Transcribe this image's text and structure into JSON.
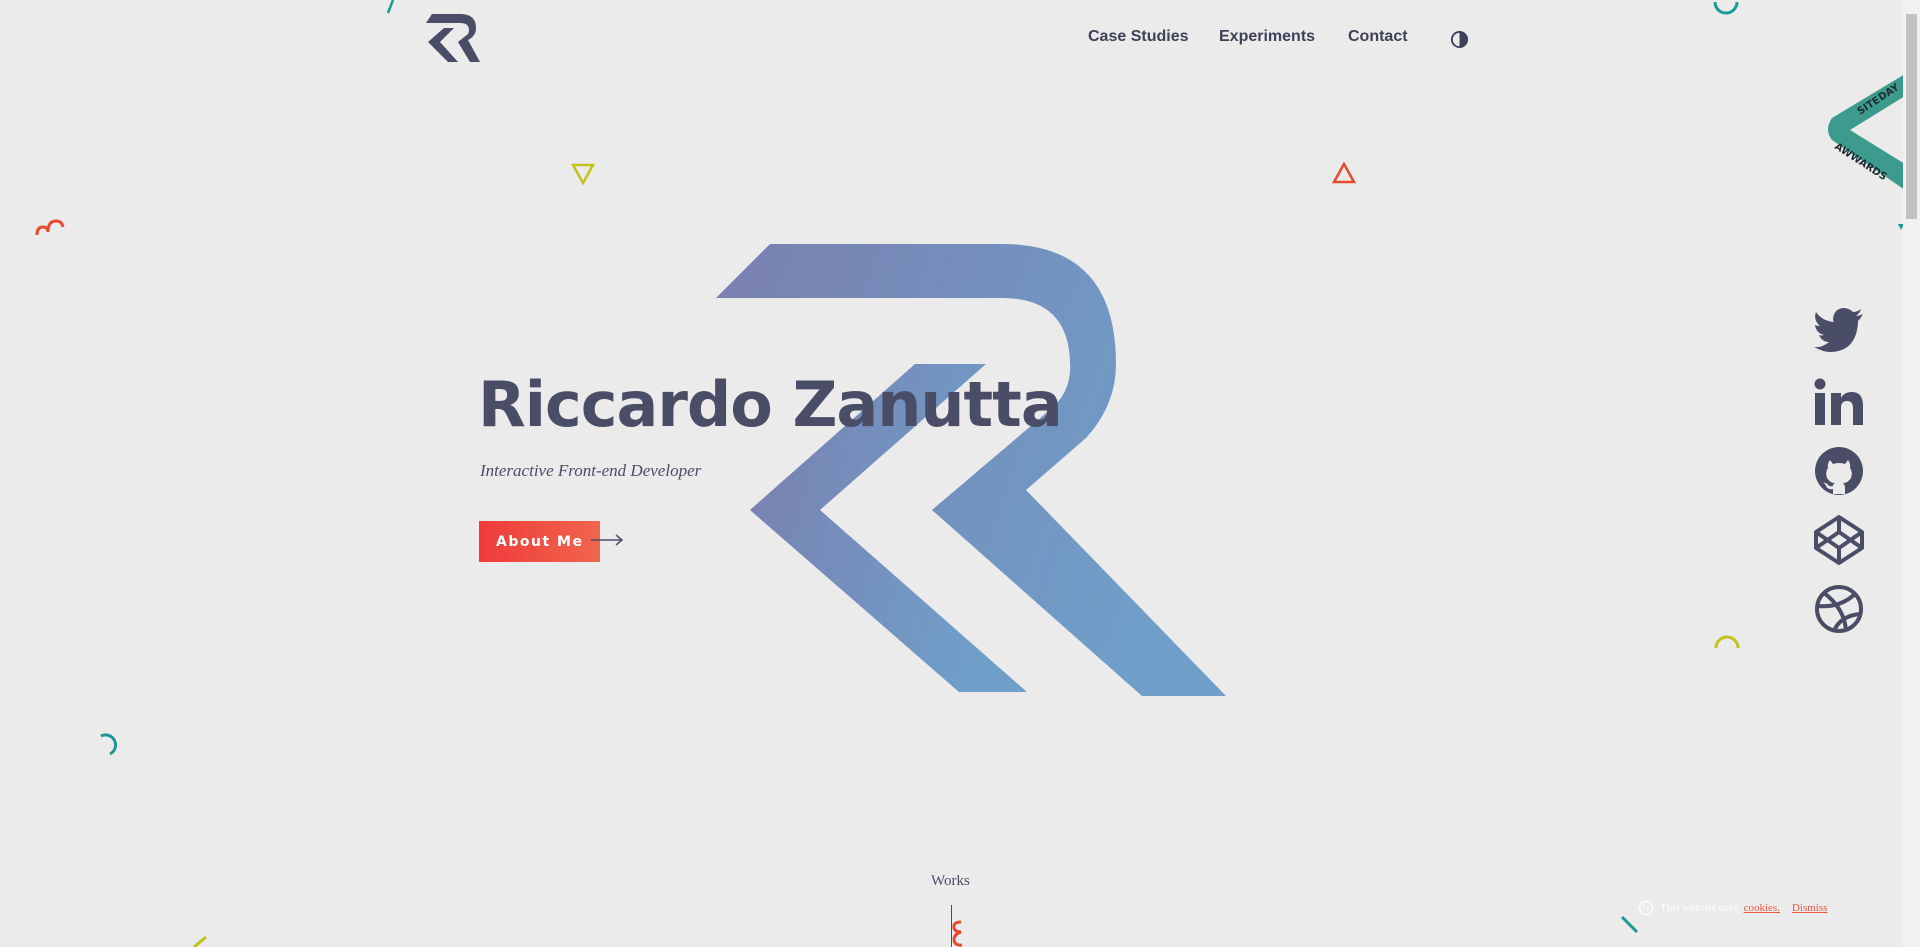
{
  "header": {
    "logo_name": "rz-monogram-logo",
    "nav": [
      {
        "label": "Case Studies"
      },
      {
        "label": "Experiments"
      },
      {
        "label": "Contact"
      }
    ],
    "theme_toggle_icon": "contrast-icon"
  },
  "hero": {
    "title": "Riccardo Zanutta",
    "subtitle": "Interactive Front-end Developer",
    "cta_label": "About Me",
    "cta_arrow_icon": "arrow-right-icon"
  },
  "social": [
    {
      "name": "twitter-icon"
    },
    {
      "name": "linkedin-icon"
    },
    {
      "name": "github-icon"
    },
    {
      "name": "codepen-icon"
    },
    {
      "name": "dribbble-icon"
    }
  ],
  "award": {
    "line1": "SITE",
    "line1b": "OF THE",
    "line1c": "DAY",
    "line2": "AWWARDS"
  },
  "works": {
    "label": "Works"
  },
  "cookie": {
    "text": "This website uses",
    "link": "cookies.",
    "dismiss": "Dismiss"
  },
  "colors": {
    "background": "#ebebeb",
    "text": "#4a4d66",
    "accent_red": "#ef3b3a",
    "accent_orange": "#f0654d",
    "accent_teal": "#1a9a94",
    "accent_yellow": "#c3c21c",
    "ribbon": "#3d9b8e",
    "logo_gradient_start": "#7a7fb0",
    "logo_gradient_end": "#6f9fc9"
  }
}
